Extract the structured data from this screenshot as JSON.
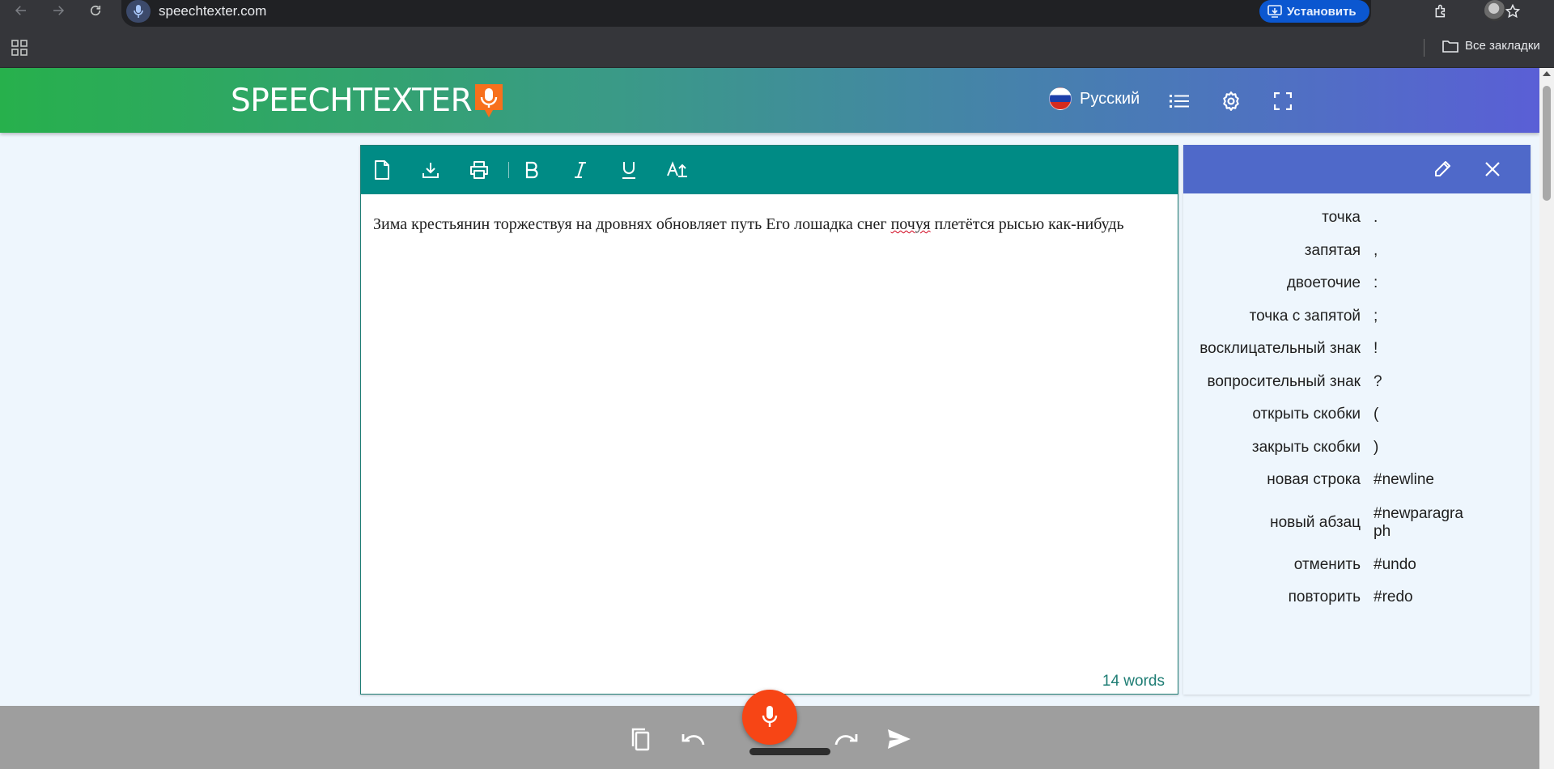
{
  "browser": {
    "url": "speechtexter.com",
    "install_label": "Установить",
    "all_bookmarks_label": "Все закладки",
    "icons": [
      "back-arrow-icon",
      "forward-arrow-icon",
      "reload-icon",
      "microphone-icon",
      "install-app-icon",
      "star-icon",
      "extensions-icon",
      "apps-grid-icon",
      "folder-icon"
    ]
  },
  "app": {
    "logo_text": "SPEECHTEXTER",
    "language": "Русский",
    "header_icons": [
      "russia-flag-icon",
      "list-icon",
      "gear-icon",
      "fullscreen-icon"
    ]
  },
  "editor": {
    "toolbar_icons": [
      "new-document-icon",
      "download-icon",
      "print-icon",
      "bold-icon",
      "italic-icon",
      "underline-icon",
      "text-size-icon"
    ],
    "text_before": "Зима крестьянин торжествуя на дровнях обновляет путь Его лошадка снег ",
    "text_misspelled": "почуя",
    "text_after": " плетётся рысью как-нибудь",
    "word_count": "14 words"
  },
  "commands": {
    "header_icons": [
      "pencil-icon",
      "close-icon"
    ],
    "items": [
      {
        "name": "точка",
        "symbol": "."
      },
      {
        "name": "запятая",
        "symbol": ","
      },
      {
        "name": "двоеточие",
        "symbol": ":"
      },
      {
        "name": "точка с запятой",
        "symbol": ";"
      },
      {
        "name": "восклицательный знак",
        "symbol": "!"
      },
      {
        "name": "вопросительный знак",
        "symbol": "?"
      },
      {
        "name": "открыть скобки",
        "symbol": "("
      },
      {
        "name": "закрыть скобки",
        "symbol": ")"
      },
      {
        "name": "новая строка",
        "symbol": "#newline"
      },
      {
        "name": "новый абзац",
        "symbol": "#newparagraph"
      },
      {
        "name": "отменить",
        "symbol": "#undo"
      },
      {
        "name": "повторить",
        "symbol": "#redo"
      }
    ]
  },
  "bottom_bar": {
    "icons": [
      "copy-icon",
      "undo-icon",
      "microphone-icon",
      "redo-icon",
      "send-icon"
    ],
    "mic_color": "#f74515"
  },
  "colors": {
    "toolbar": "#008b85",
    "commands_header": "#4f69c9",
    "header_gradient_start": "#27b04c",
    "header_gradient_end": "#5a5fd6",
    "word_count": "#1e7d74"
  }
}
